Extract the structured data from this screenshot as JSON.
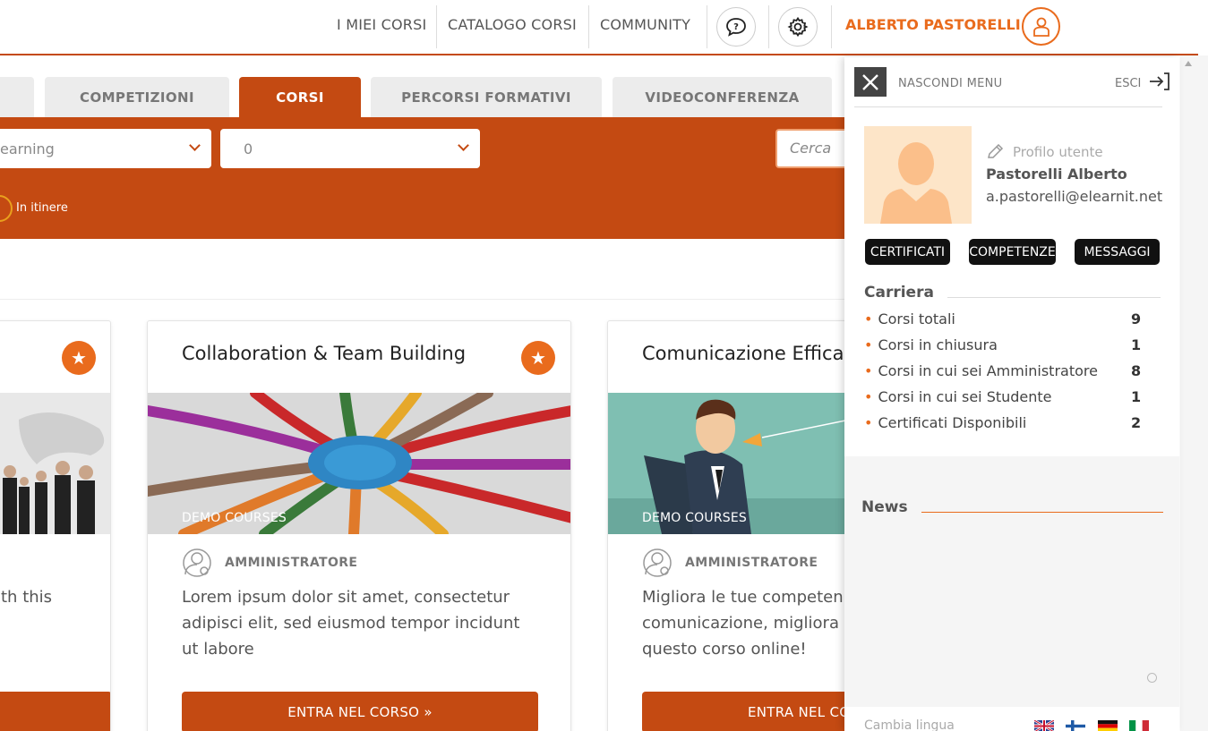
{
  "topnav": {
    "links": [
      "I MIEI CORSI",
      "CATALOGO CORSI",
      "COMMUNITY"
    ],
    "help_icon": "help-bubble-icon",
    "settings_icon": "gear-icon",
    "user_name": "ALBERTO PASTORELLI",
    "user_icon": "user-icon"
  },
  "tabs": [
    {
      "label": "COMPETIZIONI",
      "active": false
    },
    {
      "label": "CORSI",
      "active": true
    },
    {
      "label": "PERCORSI FORMATIVI",
      "active": false
    },
    {
      "label": "VIDEOCONFERENZA",
      "active": false
    }
  ],
  "filters": {
    "select1_value": "earning",
    "select2_value": "0",
    "search_placeholder": "Cerca",
    "status_label": "In itinere"
  },
  "cards": [
    {
      "title": "",
      "desc": "th this",
      "caption": "",
      "role": "",
      "button": ""
    },
    {
      "title": "Collaboration & Team Building",
      "caption": "DEMO COURSES",
      "role": "AMMINISTRATORE",
      "desc": "Lorem ipsum dolor sit amet, consectetur adipisci elit, sed eiusmod tempor incidunt ut labore",
      "button": "ENTRA NEL CORSO  »"
    },
    {
      "title": "Comunicazione Effica",
      "caption": "DEMO COURSES",
      "role": "AMMINISTRATORE",
      "desc": "Migliora le tue competen comunicazione, migliora questo corso online!",
      "button": "ENTRA NEL CO"
    }
  ],
  "panel": {
    "hide_label": "NASCONDI MENU",
    "exit_label": "ESCI",
    "profile_link": "Profilo utente",
    "name": "Pastorelli Alberto",
    "email": "a.pastorelli@elearnit.net",
    "pills": [
      "CERTIFICATI",
      "COMPETENZE",
      "MESSAGGI"
    ],
    "career_title": "Carriera",
    "stats": [
      {
        "label": "Corsi totali",
        "value": "9"
      },
      {
        "label": "Corsi in chiusura",
        "value": "1"
      },
      {
        "label": "Corsi in cui sei Amministratore",
        "value": "8"
      },
      {
        "label": "Corsi in cui sei Studente",
        "value": "1"
      },
      {
        "label": "Certificati Disponibili",
        "value": "2"
      }
    ],
    "news_title": "News",
    "lang_label": "Cambia lingua",
    "flags": [
      "uk-flag-icon",
      "finland-flag-icon",
      "germany-flag-icon",
      "italy-flag-icon"
    ]
  },
  "colors": {
    "brand_dark": "#c44a12",
    "brand_accent": "#e96b1d"
  }
}
